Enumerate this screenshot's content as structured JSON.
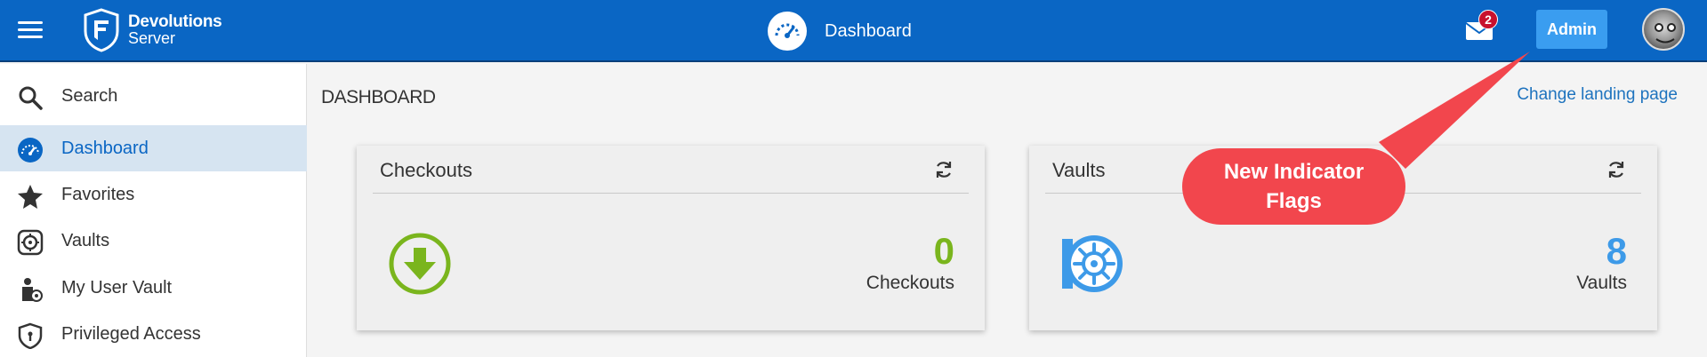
{
  "brand": {
    "name_line1": "Devolutions",
    "name_line2": "Server"
  },
  "header": {
    "title": "Dashboard",
    "mail_badge": "2",
    "admin_label": "Admin"
  },
  "sidebar": {
    "items": [
      {
        "label": "Search",
        "icon": "search-icon"
      },
      {
        "label": "Dashboard",
        "icon": "dashboard-gauge-icon",
        "active": true
      },
      {
        "label": "Favorites",
        "icon": "star-icon"
      },
      {
        "label": "Vaults",
        "icon": "vault-icon"
      },
      {
        "label": "My User Vault",
        "icon": "user-vault-icon"
      },
      {
        "label": "Privileged Access",
        "icon": "shield-icon"
      }
    ]
  },
  "main": {
    "title": "DASHBOARD",
    "change_landing": "Change landing page",
    "cards": [
      {
        "title": "Checkouts",
        "value": "0",
        "caption": "Checkouts",
        "color": "#7ab51d",
        "icon": "download-circle-icon"
      },
      {
        "title": "Vaults",
        "value": "8",
        "caption": "Vaults",
        "color": "#3d9ae8",
        "icon": "vault-wheel-icon"
      }
    ]
  },
  "callout": {
    "line1": "New Indicator",
    "line2": "Flags",
    "color": "#f2464d"
  },
  "colors": {
    "topbar": "#0a66c4",
    "active_bg": "#d6e4f1",
    "admin_button": "#3a9df0",
    "badge": "#c8102e"
  }
}
